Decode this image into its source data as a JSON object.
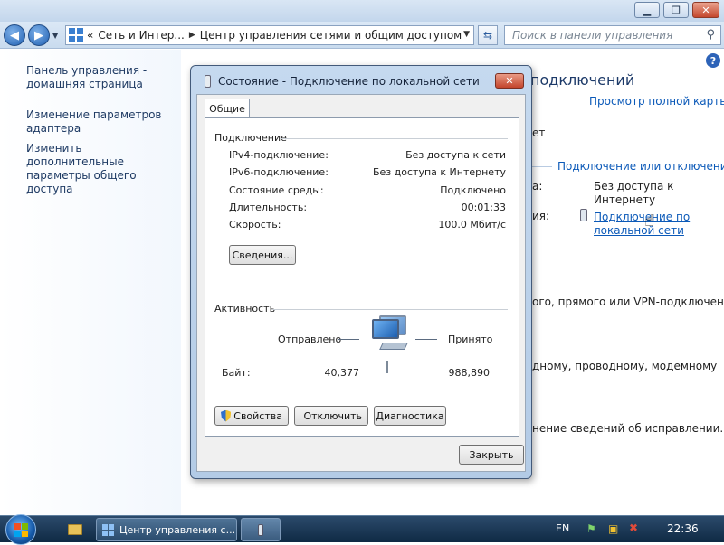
{
  "window": {
    "caption_min": "▁",
    "caption_max": "❐",
    "caption_close": "✕"
  },
  "navbar": {
    "back_glyph": "◀",
    "forward_glyph": "▶",
    "address_prefix": "«",
    "breadcrumb": [
      "Сеть и Интер...",
      "Центр управления сетями и общим доступом"
    ],
    "search_placeholder": "Поиск в панели управления"
  },
  "left_pane": {
    "items": [
      "Панель управления - домашняя страница",
      "Изменение параметров адаптера",
      "Изменить дополнительные параметры общего доступа"
    ]
  },
  "main_bg": {
    "heading_fragment": "подключений",
    "view_full_map": "Просмотр полной карты",
    "network_fragment": "ет",
    "connect_disconnect": "Подключение или отключение",
    "access_label_fragment": "а:",
    "access_value": "Без доступа к Интернету",
    "connections_label_fragment": "ия:",
    "connection_link": "Подключение по локальной сети",
    "setup_fragment": "ого, прямого или VPN-подключения",
    "connect_fragment": "дному, проводному, модемному",
    "troubleshoot_fragment": "нение сведений об исправлении."
  },
  "dialog": {
    "title": "Состояние - Подключение по локальной сети",
    "tab_general": "Общие",
    "connection_group": "Подключение",
    "rows": [
      {
        "label": "IPv4-подключение:",
        "value": "Без доступа к сети"
      },
      {
        "label": "IPv6-подключение:",
        "value": "Без доступа к Интернету"
      },
      {
        "label": "Состояние среды:",
        "value": "Подключено"
      },
      {
        "label": "Длительность:",
        "value": "00:01:33"
      },
      {
        "label": "Скорость:",
        "value": "100.0 Мбит/с"
      }
    ],
    "details_button": "Сведения...",
    "activity_group": "Активность",
    "sent_label": "Отправлено",
    "received_label": "Принято",
    "bytes_label": "Байт:",
    "bytes_sent": "40,377",
    "bytes_received": "988,890",
    "properties_button": "Свойства",
    "disable_button": "Отключить",
    "diagnose_button": "Диагностика",
    "close_button": "Закрыть"
  },
  "taskbar": {
    "task_label": "Центр управления с...",
    "language": "EN",
    "clock": "22:36"
  },
  "colors": {
    "taskbar": "#0f2a44",
    "dialog_frame": "#b9cfe9",
    "link": "#0b59b8"
  }
}
